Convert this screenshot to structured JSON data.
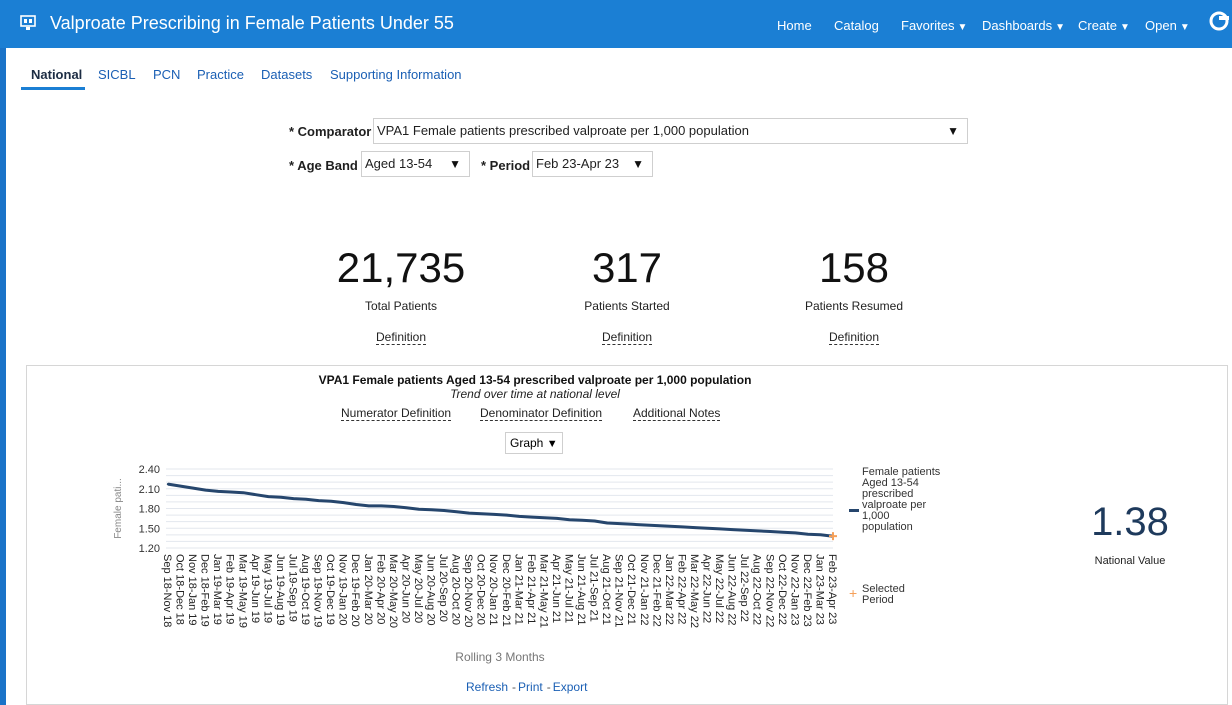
{
  "header": {
    "title": "Valproate Prescribing in Female Patients Under 55",
    "nav": [
      "Home",
      "Catalog",
      "Favorites",
      "Dashboards",
      "Create",
      "Open"
    ]
  },
  "tabs": [
    "National",
    "SICBL",
    "PCN",
    "Practice",
    "Datasets",
    "Supporting Information"
  ],
  "prompts": {
    "comparator_label": "* Comparator",
    "comparator_value": "VPA1 Female patients prescribed valproate per 1,000 population",
    "ageband_label": "* Age Band",
    "ageband_value": "Aged 13-54",
    "period_label": "* Period",
    "period_value": "Feb 23-Apr 23"
  },
  "kpis": [
    {
      "value": "21,735",
      "label": "Total Patients",
      "link": "Definition"
    },
    {
      "value": "317",
      "label": "Patients Started",
      "link": "Definition"
    },
    {
      "value": "158",
      "label": "Patients Resumed",
      "link": "Definition"
    }
  ],
  "chart_panel": {
    "title": "VPA1 Female patients Aged 13-54 prescribed valproate per 1,000 population",
    "subtitle": "Trend over time at national level",
    "links": [
      "Numerator Definition",
      "Denominator Definition",
      "Additional Notes"
    ],
    "view_select": "Graph",
    "legend_series": "Female patients Aged 13-54 prescribed valproate per 1,000 population",
    "legend_selected": "Selected Period",
    "national_value": "1.38",
    "national_label": "National Value",
    "footer": [
      "Refresh",
      "Print",
      "Export"
    ]
  },
  "chart_data": {
    "type": "line",
    "ylabel": "Female pati...",
    "xlabel": "Rolling 3 Months",
    "ylim": [
      1.2,
      2.4
    ],
    "yticks": [
      "2.40",
      "2.10",
      "1.80",
      "1.50",
      "1.20"
    ],
    "categories": [
      "Sep 18-Nov 18",
      "Oct 18-Dec 18",
      "Nov 18-Jan 19",
      "Dec 18-Feb 19",
      "Jan 19-Mar 19",
      "Feb 19-Apr 19",
      "Mar 19-May 19",
      "Apr 19-Jun 19",
      "May 19-Jul 19",
      "Jun 19-Aug 19",
      "Jul 19-Sep 19",
      "Aug 19-Oct 19",
      "Sep 19-Nov 19",
      "Oct 19-Dec 19",
      "Nov 19-Jan 20",
      "Dec 19-Feb 20",
      "Jan 20-Mar 20",
      "Feb 20-Apr 20",
      "Mar 20-May 20",
      "Apr 20-Jun 20",
      "May 20-Jul 20",
      "Jun 20-Aug 20",
      "Jul 20-Sep 20",
      "Aug 20-Oct 20",
      "Sep 20-Nov 20",
      "Oct 20-Dec 20",
      "Nov 20-Jan 21",
      "Dec 20-Feb 21",
      "Jan 21-Mar 21",
      "Feb 21-Apr 21",
      "Mar 21-May 21",
      "Apr 21-Jun 21",
      "May 21-Jul 21",
      "Jun 21-Aug 21",
      "Jul 21-Sep 21",
      "Aug 21-Oct 21",
      "Sep 21-Nov 21",
      "Oct 21-Dec 21",
      "Nov 21-Jan 22",
      "Dec 21-Feb 22",
      "Jan 22-Mar 22",
      "Feb 22-Apr 22",
      "Mar 22-May 22",
      "Apr 22-Jun 22",
      "May 22-Jul 22",
      "Jun 22-Aug 22",
      "Jul 22-Sep 22",
      "Aug 22-Oct 22",
      "Sep 22-Nov 22",
      "Oct 22-Dec 22",
      "Nov 22-Jan 23",
      "Dec 22-Feb 23",
      "Jan 23-Mar 23",
      "Feb 23-Apr 23"
    ],
    "series": [
      {
        "name": "Female patients Aged 13-54 prescribed valproate per 1,000 population",
        "values": [
          2.17,
          2.14,
          2.11,
          2.08,
          2.06,
          2.05,
          2.04,
          2.01,
          1.98,
          1.97,
          1.95,
          1.94,
          1.92,
          1.91,
          1.89,
          1.86,
          1.84,
          1.84,
          1.83,
          1.81,
          1.79,
          1.78,
          1.77,
          1.75,
          1.73,
          1.72,
          1.71,
          1.7,
          1.68,
          1.67,
          1.66,
          1.65,
          1.63,
          1.62,
          1.61,
          1.58,
          1.57,
          1.56,
          1.55,
          1.54,
          1.53,
          1.52,
          1.51,
          1.5,
          1.49,
          1.48,
          1.47,
          1.46,
          1.45,
          1.44,
          1.43,
          1.41,
          1.4,
          1.38
        ]
      }
    ],
    "selected_period": "Feb 23-Apr 23",
    "legend_position": "right"
  }
}
